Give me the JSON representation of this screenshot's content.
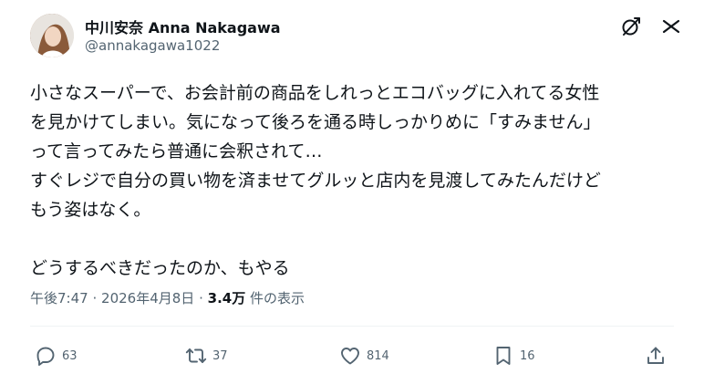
{
  "author": {
    "display_name": "中川安奈 Anna Nakagawa",
    "handle": "@annakagawa1022"
  },
  "tweet": {
    "text": "小さなスーパーで、お会計前の商品をしれっとエコバッグに入れてる女性\nを見かけてしまい。気になって後ろを通る時しっかりめに「すみません」\nって言ってみたら普通に会釈されて…\nすぐレジで自分の買い物を済ませてグルッと店内を見渡してみたんだけど\nもう姿はなく。\n\nどうするべきだったのか、もやる"
  },
  "meta": {
    "time": "午後7:47",
    "separator": "·",
    "date": "2026年4月8日",
    "views_count": "3.4万",
    "views_label": "件の表示"
  },
  "actions": {
    "reply_count": "63",
    "retweet_count": "37",
    "like_count": "814",
    "bookmark_count": "16"
  },
  "icons": {
    "avatar": "avatar-photo",
    "grok": "grok-icon",
    "more": "more-icon",
    "reply": "reply-icon",
    "retweet": "retweet-icon",
    "like": "heart-icon",
    "bookmark": "bookmark-icon",
    "share": "share-icon"
  },
  "colors": {
    "text": "#0f1419",
    "secondary": "#536471",
    "divider": "#eff3f4"
  }
}
